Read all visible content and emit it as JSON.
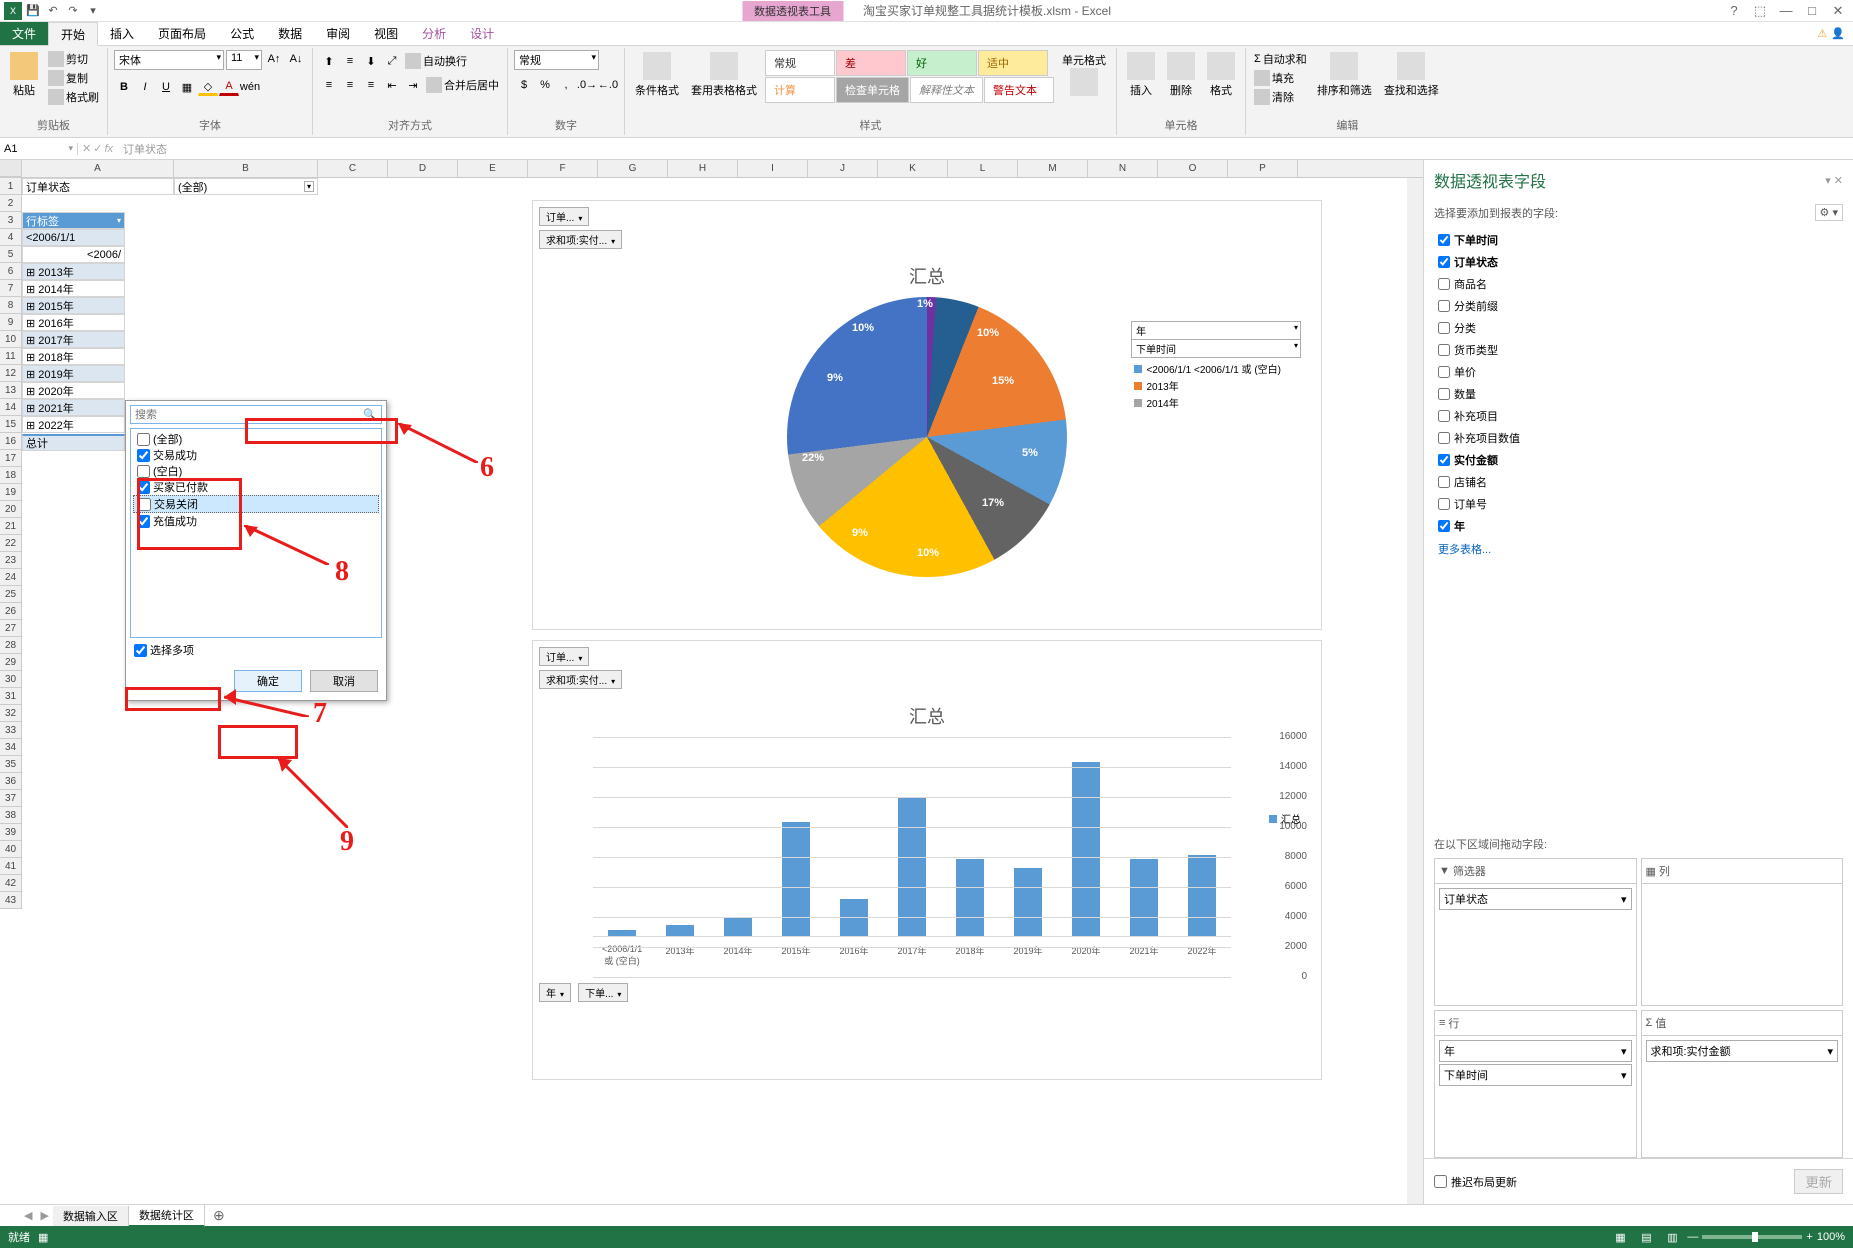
{
  "titlebar": {
    "doc": "淘宝买家订单规整工具据统计模板.xlsm - Excel",
    "context_tab": "数据透视表工具"
  },
  "tabs": {
    "file": "文件",
    "home": "开始",
    "insert": "插入",
    "layout": "页面布局",
    "formula": "公式",
    "data": "数据",
    "review": "审阅",
    "view": "视图",
    "analyze": "分析",
    "design": "设计"
  },
  "ribbon": {
    "clipboard": {
      "paste": "粘贴",
      "cut": "剪切",
      "copy": "复制",
      "brush": "格式刷",
      "label": "剪贴板"
    },
    "font": {
      "name": "宋体",
      "size": "11",
      "label": "字体"
    },
    "align": {
      "wrap": "自动换行",
      "merge": "合并后居中",
      "label": "对齐方式"
    },
    "number": {
      "format": "常规",
      "label": "数字"
    },
    "styles": {
      "cond": "条件格式",
      "table": "套用表格格式",
      "normal": "常规",
      "bad": "差",
      "good": "好",
      "neutral": "适中",
      "calc": "计算",
      "check": "检查单元格",
      "explain": "解释性文本",
      "warn": "警告文本",
      "label": "样式"
    },
    "cellsfmt": {
      "cell_format": "单元格式"
    },
    "cells": {
      "insert": "插入",
      "delete": "删除",
      "format": "格式",
      "label": "单元格"
    },
    "edit": {
      "sum": "自动求和",
      "fill": "填充",
      "clear": "清除",
      "sort": "排序和筛选",
      "find": "查找和选择",
      "label": "编辑"
    }
  },
  "formula_bar": {
    "name": "A1",
    "fx": "fx",
    "value": "订单状态"
  },
  "pivot": {
    "filter_label": "订单状态",
    "filter_value": "(全部)",
    "row_labels": "行标签",
    "row0": "<2006/1/1",
    "row0b": "<2006/",
    "years": [
      "2013年",
      "2014年",
      "2015年",
      "2016年",
      "2017年",
      "2018年",
      "2019年",
      "2020年",
      "2021年",
      "2022年"
    ],
    "total": "总计"
  },
  "dropdown": {
    "search": "搜索",
    "all": "(全部)",
    "items": [
      "交易成功",
      "(空白)",
      "买家已付款",
      "交易关闭",
      "充值成功"
    ],
    "multi": "选择多项",
    "ok": "确定",
    "cancel": "取消"
  },
  "annotations": {
    "n6": "6",
    "n7": "7",
    "n8": "8",
    "n9": "9"
  },
  "charts": {
    "title": "汇总",
    "btn_order": "订单...",
    "btn_sum": "求和项:实付...",
    "btn_year": "年",
    "btn_time": "下单时间",
    "btn_time2": "下单...",
    "pie_filter1": "年",
    "pie_filter2": "下单时间",
    "legend": [
      "<2006/1/1 <2006/1/1 或 (空白)",
      "2013年",
      "2014年"
    ],
    "bar_legend": "汇总"
  },
  "chart_data": [
    {
      "type": "pie",
      "title": "汇总",
      "values_pct": [
        1,
        10,
        15,
        5,
        17,
        10,
        9,
        22,
        9,
        10
      ],
      "labels": [
        "1%",
        "10%",
        "15%",
        "5%",
        "17%",
        "10%",
        "9%",
        "22%",
        "9%",
        "10%"
      ],
      "colors": [
        "#9e480e",
        "#70ad47",
        "#7030a0",
        "#255e91",
        "#ed7d31",
        "#5b9bd5",
        "#636363",
        "#ffc000",
        "#a5a5a5",
        "#4472c4"
      ],
      "legend_entries": [
        "<2006/1/1 <2006/1/1 或 (空白)",
        "2013年",
        "2014年"
      ],
      "legend_colors": [
        "#5b9bd5",
        "#ed7d31",
        "#a5a5a5"
      ]
    },
    {
      "type": "bar",
      "title": "汇总",
      "categories": [
        "<2006/1/1 或 (空白)",
        "2013年",
        "2014年",
        "2015年",
        "2016年",
        "2017年",
        "2018年",
        "2019年",
        "2020年",
        "2021年",
        "2022年"
      ],
      "values": [
        500,
        900,
        1500,
        9200,
        3000,
        11200,
        6200,
        5500,
        14000,
        6200,
        6500
      ],
      "ylabel": "",
      "ylim": [
        0,
        16000
      ],
      "yticks": [
        0,
        2000,
        4000,
        6000,
        8000,
        10000,
        12000,
        14000,
        16000
      ],
      "legend": "汇总"
    }
  ],
  "field_pane": {
    "title": "数据透视表字段",
    "subtitle": "选择要添加到报表的字段:",
    "fields": [
      {
        "label": "下单时间",
        "checked": true
      },
      {
        "label": "订单状态",
        "checked": true
      },
      {
        "label": "商品名",
        "checked": false
      },
      {
        "label": "分类前缀",
        "checked": false
      },
      {
        "label": "分类",
        "checked": false
      },
      {
        "label": "货币类型",
        "checked": false
      },
      {
        "label": "单价",
        "checked": false
      },
      {
        "label": "数量",
        "checked": false
      },
      {
        "label": "补充项目",
        "checked": false
      },
      {
        "label": "补充项目数值",
        "checked": false
      },
      {
        "label": "实付金额",
        "checked": true
      },
      {
        "label": "店铺名",
        "checked": false
      },
      {
        "label": "订单号",
        "checked": false
      },
      {
        "label": "年",
        "checked": true
      }
    ],
    "more": "更多表格...",
    "areas_label": "在以下区域间拖动字段:",
    "filter_h": "筛选器",
    "col_h": "列",
    "row_h": "行",
    "value_h": "值",
    "filter_items": [
      "订单状态"
    ],
    "row_items": [
      "年",
      "下单时间"
    ],
    "value_items": [
      "求和项:实付金额"
    ],
    "defer": "推迟布局更新",
    "update": "更新"
  },
  "sheets": {
    "tab1": "数据输入区",
    "tab2": "数据统计区"
  },
  "status": {
    "ready": "就绪",
    "zoom": "100%"
  },
  "columns": [
    "A",
    "B",
    "C",
    "D",
    "E",
    "F",
    "G",
    "H",
    "I",
    "J",
    "K",
    "L",
    "M",
    "N",
    "O",
    "P"
  ]
}
